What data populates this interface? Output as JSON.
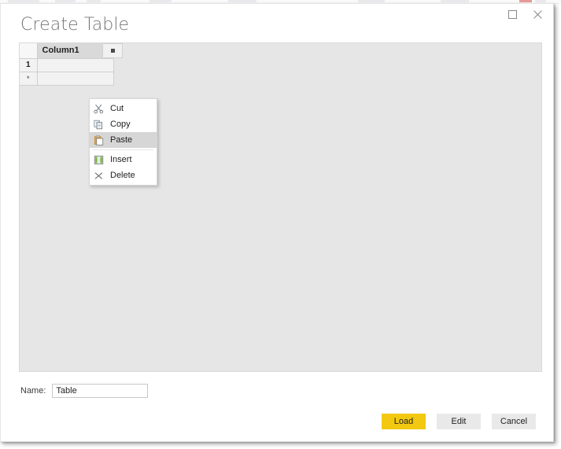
{
  "window": {
    "title": "Create Table",
    "controls": [
      {
        "name": "maximize-button",
        "icon": "maximize-icon",
        "label": "Maximize"
      },
      {
        "name": "close-button",
        "icon": "close-icon",
        "label": "Close"
      }
    ]
  },
  "grid": {
    "corner_label": "",
    "columns": [
      {
        "header": "Column1",
        "filter_icon": "dropdown-filter-icon"
      }
    ],
    "rows": [
      {
        "row_header": "1",
        "cells": [
          ""
        ]
      },
      {
        "row_header": "*",
        "cells": [
          ""
        ]
      }
    ]
  },
  "context_menu": {
    "items": [
      {
        "label": "Cut",
        "icon": "scissors-icon",
        "selected": false,
        "separator_after": false
      },
      {
        "label": "Copy",
        "icon": "copy-icon",
        "selected": false,
        "separator_after": false
      },
      {
        "label": "Paste",
        "icon": "clipboard-icon",
        "selected": true,
        "separator_after": true
      },
      {
        "label": "Insert",
        "icon": "insert-column-icon",
        "selected": false,
        "separator_after": false
      },
      {
        "label": "Delete",
        "icon": "delete-x-icon",
        "selected": false,
        "separator_after": false
      }
    ]
  },
  "name_field": {
    "label": "Name:",
    "value": "Table",
    "placeholder": "Table"
  },
  "footer": {
    "buttons": [
      {
        "label": "Load",
        "style": "primary"
      },
      {
        "label": "Edit",
        "style": "secondary"
      },
      {
        "label": "Cancel",
        "style": "secondary"
      }
    ]
  },
  "colors": {
    "accent": "#f2c811",
    "panel_bg": "#e6e6e6",
    "header_bg": "#d9d9d9",
    "cell_bg": "#f2f2f2",
    "menu_selected": "#d6d6d6",
    "title_text": "#757575"
  }
}
